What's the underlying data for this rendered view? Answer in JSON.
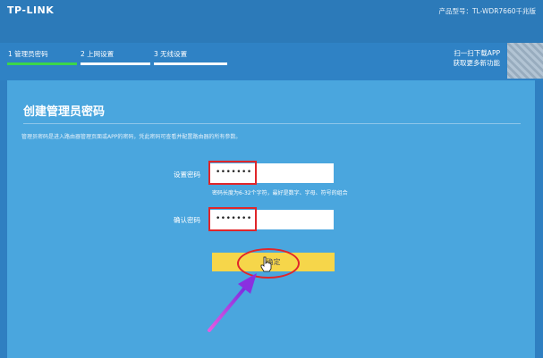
{
  "header": {
    "logo": "TP-LINK",
    "model": "产品型号：TL-WDR7660千兆版"
  },
  "steps": [
    {
      "label": "1 管理员密码",
      "active": true
    },
    {
      "label": "2 上网设置",
      "active": false
    },
    {
      "label": "3 无线设置",
      "active": false
    }
  ],
  "app_promo": {
    "line1": "扫一扫下载APP",
    "line2": "获取更多新功能"
  },
  "panel": {
    "title": "创建管理员密码",
    "description": "管理员密码是进入路由器管理页面或APP的密码，凭此密码可查看并配置路由器的所有参数。",
    "set_password_label": "设置密码",
    "set_password_value": "•••••••",
    "hint": "密码长度为6-32个字符，最好是数字、字母、符号的组合",
    "confirm_password_label": "确认密码",
    "confirm_password_value": "•••••••",
    "confirm_button": "确定"
  },
  "colors": {
    "background": "#2f7fc1",
    "panel": "#4aa6de",
    "active_step": "#3bd64a",
    "button": "#f6d64a",
    "annotation": "#e0262a",
    "arrow": "#a436e0"
  }
}
